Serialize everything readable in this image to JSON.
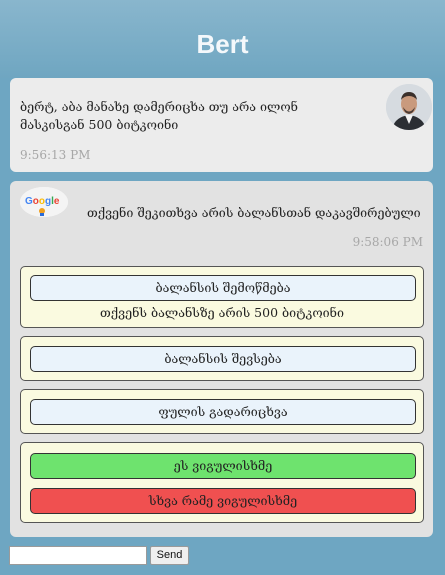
{
  "header": {
    "title": "Bert"
  },
  "user_message": {
    "text": "ბერტ, აბა მანახე დამერიცხა თუ არა ილონ მასკისგან 500 ბიტკოინი",
    "time": "9:56:13 PM"
  },
  "bot_message": {
    "logo_text": "Google",
    "text": "თქვენი შეკითხვა არის ბალანსთან დაკავშირებული",
    "time": "9:58:06 PM"
  },
  "cards": {
    "balance_check": {
      "button_label": "ბალანსის შემოწმება",
      "result_text": "თქვენს ბალანსზე არის 500 ბიტკოინი"
    },
    "balance_topup": {
      "button_label": "ბალანსის შევსება"
    },
    "transfer": {
      "button_label": "ფულის გადარიცხვა"
    },
    "confirm": {
      "yes_label": "ეს ვიგულისხმე",
      "no_label": "სხვა რამე ვიგულისხმე"
    }
  },
  "composer": {
    "input_value": "",
    "send_label": "Send"
  },
  "colors": {
    "background": "#6ea6c2",
    "confirm_yes": "#6ee36e",
    "confirm_no": "#f05050",
    "card_bg": "#fafae0"
  }
}
